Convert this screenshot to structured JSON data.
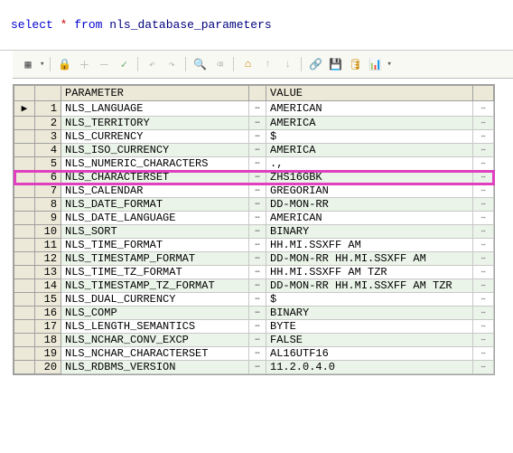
{
  "sql": {
    "select": "select",
    "star": "*",
    "from": "from",
    "ident": "nls_database_parameters"
  },
  "toolbar": {
    "grid": "▦",
    "lock": "🔒",
    "plus": "＋",
    "minus": "－",
    "check": "✓",
    "undo": "↶",
    "redo": "↷",
    "find": "🔍",
    "erase": "⌫",
    "home": "⌂",
    "up": "↑",
    "down": "↓",
    "link": "🔗",
    "save": "💾",
    "db": "🛢",
    "chart": "📊"
  },
  "columns": {
    "param": "PARAMETER",
    "value": "VALUE"
  },
  "rows": [
    {
      "n": "1",
      "param": "NLS_LANGUAGE",
      "value": "AMERICAN",
      "mark": "▶"
    },
    {
      "n": "2",
      "param": "NLS_TERRITORY",
      "value": "AMERICA",
      "mark": ""
    },
    {
      "n": "3",
      "param": "NLS_CURRENCY",
      "value": "$",
      "mark": ""
    },
    {
      "n": "4",
      "param": "NLS_ISO_CURRENCY",
      "value": "AMERICA",
      "mark": ""
    },
    {
      "n": "5",
      "param": "NLS_NUMERIC_CHARACTERS",
      "value": ".,",
      "mark": ""
    },
    {
      "n": "6",
      "param": "NLS_CHARACTERSET",
      "value": "ZHS16GBK",
      "mark": "",
      "highlight": true
    },
    {
      "n": "7",
      "param": "NLS_CALENDAR",
      "value": "GREGORIAN",
      "mark": ""
    },
    {
      "n": "8",
      "param": "NLS_DATE_FORMAT",
      "value": "DD-MON-RR",
      "mark": ""
    },
    {
      "n": "9",
      "param": "NLS_DATE_LANGUAGE",
      "value": "AMERICAN",
      "mark": ""
    },
    {
      "n": "10",
      "param": "NLS_SORT",
      "value": "BINARY",
      "mark": ""
    },
    {
      "n": "11",
      "param": "NLS_TIME_FORMAT",
      "value": "HH.MI.SSXFF AM",
      "mark": ""
    },
    {
      "n": "12",
      "param": "NLS_TIMESTAMP_FORMAT",
      "value": "DD-MON-RR HH.MI.SSXFF AM",
      "mark": ""
    },
    {
      "n": "13",
      "param": "NLS_TIME_TZ_FORMAT",
      "value": "HH.MI.SSXFF AM TZR",
      "mark": ""
    },
    {
      "n": "14",
      "param": "NLS_TIMESTAMP_TZ_FORMAT",
      "value": "DD-MON-RR HH.MI.SSXFF AM TZR",
      "mark": ""
    },
    {
      "n": "15",
      "param": "NLS_DUAL_CURRENCY",
      "value": "$",
      "mark": ""
    },
    {
      "n": "16",
      "param": "NLS_COMP",
      "value": "BINARY",
      "mark": ""
    },
    {
      "n": "17",
      "param": "NLS_LENGTH_SEMANTICS",
      "value": "BYTE",
      "mark": ""
    },
    {
      "n": "18",
      "param": "NLS_NCHAR_CONV_EXCP",
      "value": "FALSE",
      "mark": ""
    },
    {
      "n": "19",
      "param": "NLS_NCHAR_CHARACTERSET",
      "value": "AL16UTF16",
      "mark": ""
    },
    {
      "n": "20",
      "param": "NLS_RDBMS_VERSION",
      "value": "11.2.0.4.0",
      "mark": ""
    }
  ],
  "dots": "⋯"
}
